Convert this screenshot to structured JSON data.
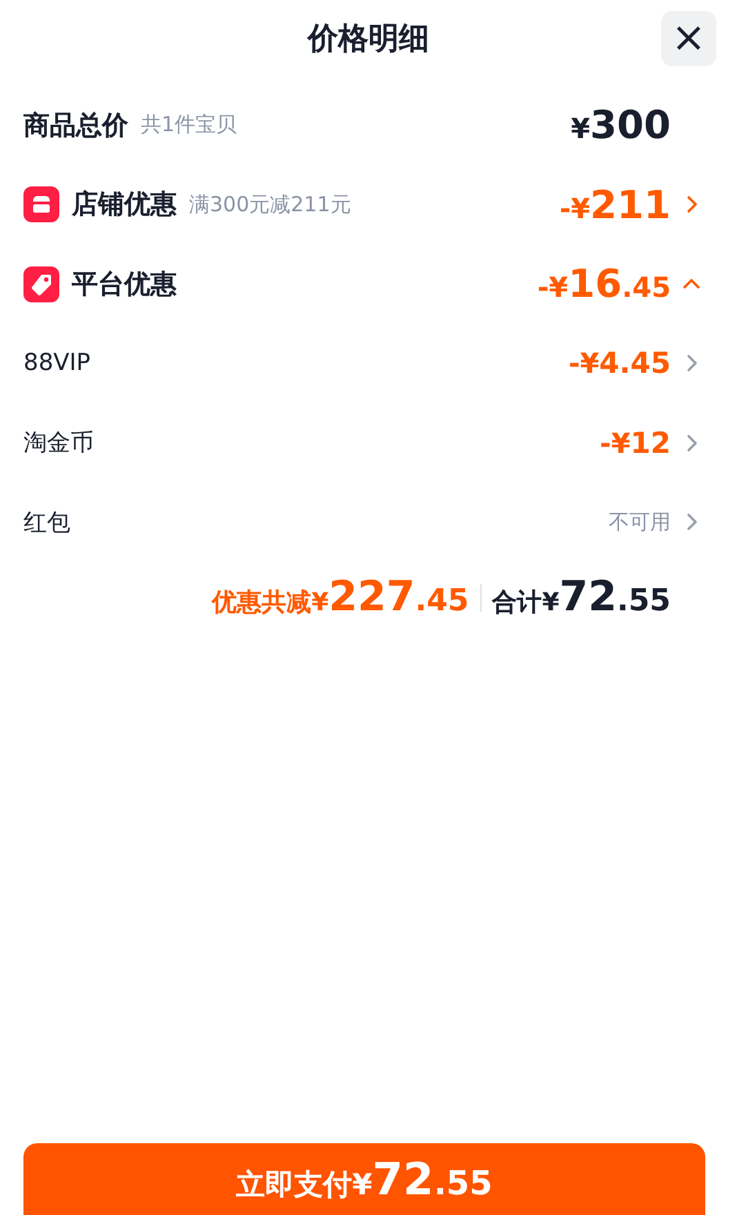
{
  "header": {
    "title": "价格明细",
    "close": "×"
  },
  "rows": [
    {
      "kind": "total",
      "label": "商品总价",
      "note": "共1件宝贝",
      "amount": {
        "prefix": "¥",
        "integer": "300"
      }
    },
    {
      "kind": "shop",
      "label": "店铺优惠",
      "note": "满300元减211元",
      "amount": {
        "prefix": "-¥",
        "integer": "211"
      }
    },
    {
      "kind": "platform",
      "label": "平台优惠",
      "amount": {
        "prefix": "-¥",
        "integer": "16",
        "decimal": ".45"
      },
      "expanded": true
    },
    {
      "kind": "item",
      "label": "88VIP",
      "amount": {
        "prefix": "-¥",
        "integer": "4.45"
      }
    },
    {
      "kind": "item",
      "label": "淘金币",
      "amount": {
        "prefix": "-¥",
        "integer": "12"
      }
    },
    {
      "kind": "item",
      "label": "红包",
      "status": "不可用"
    }
  ],
  "summary": {
    "saving": {
      "prefix": "优惠共减¥",
      "integer": "227",
      "decimal": ".45"
    },
    "total": {
      "prefix": "合计¥",
      "integer": "72",
      "decimal": ".55"
    }
  },
  "pay_button": {
    "prefix": "立即支付¥",
    "integer": "72",
    "decimal": ".55"
  }
}
